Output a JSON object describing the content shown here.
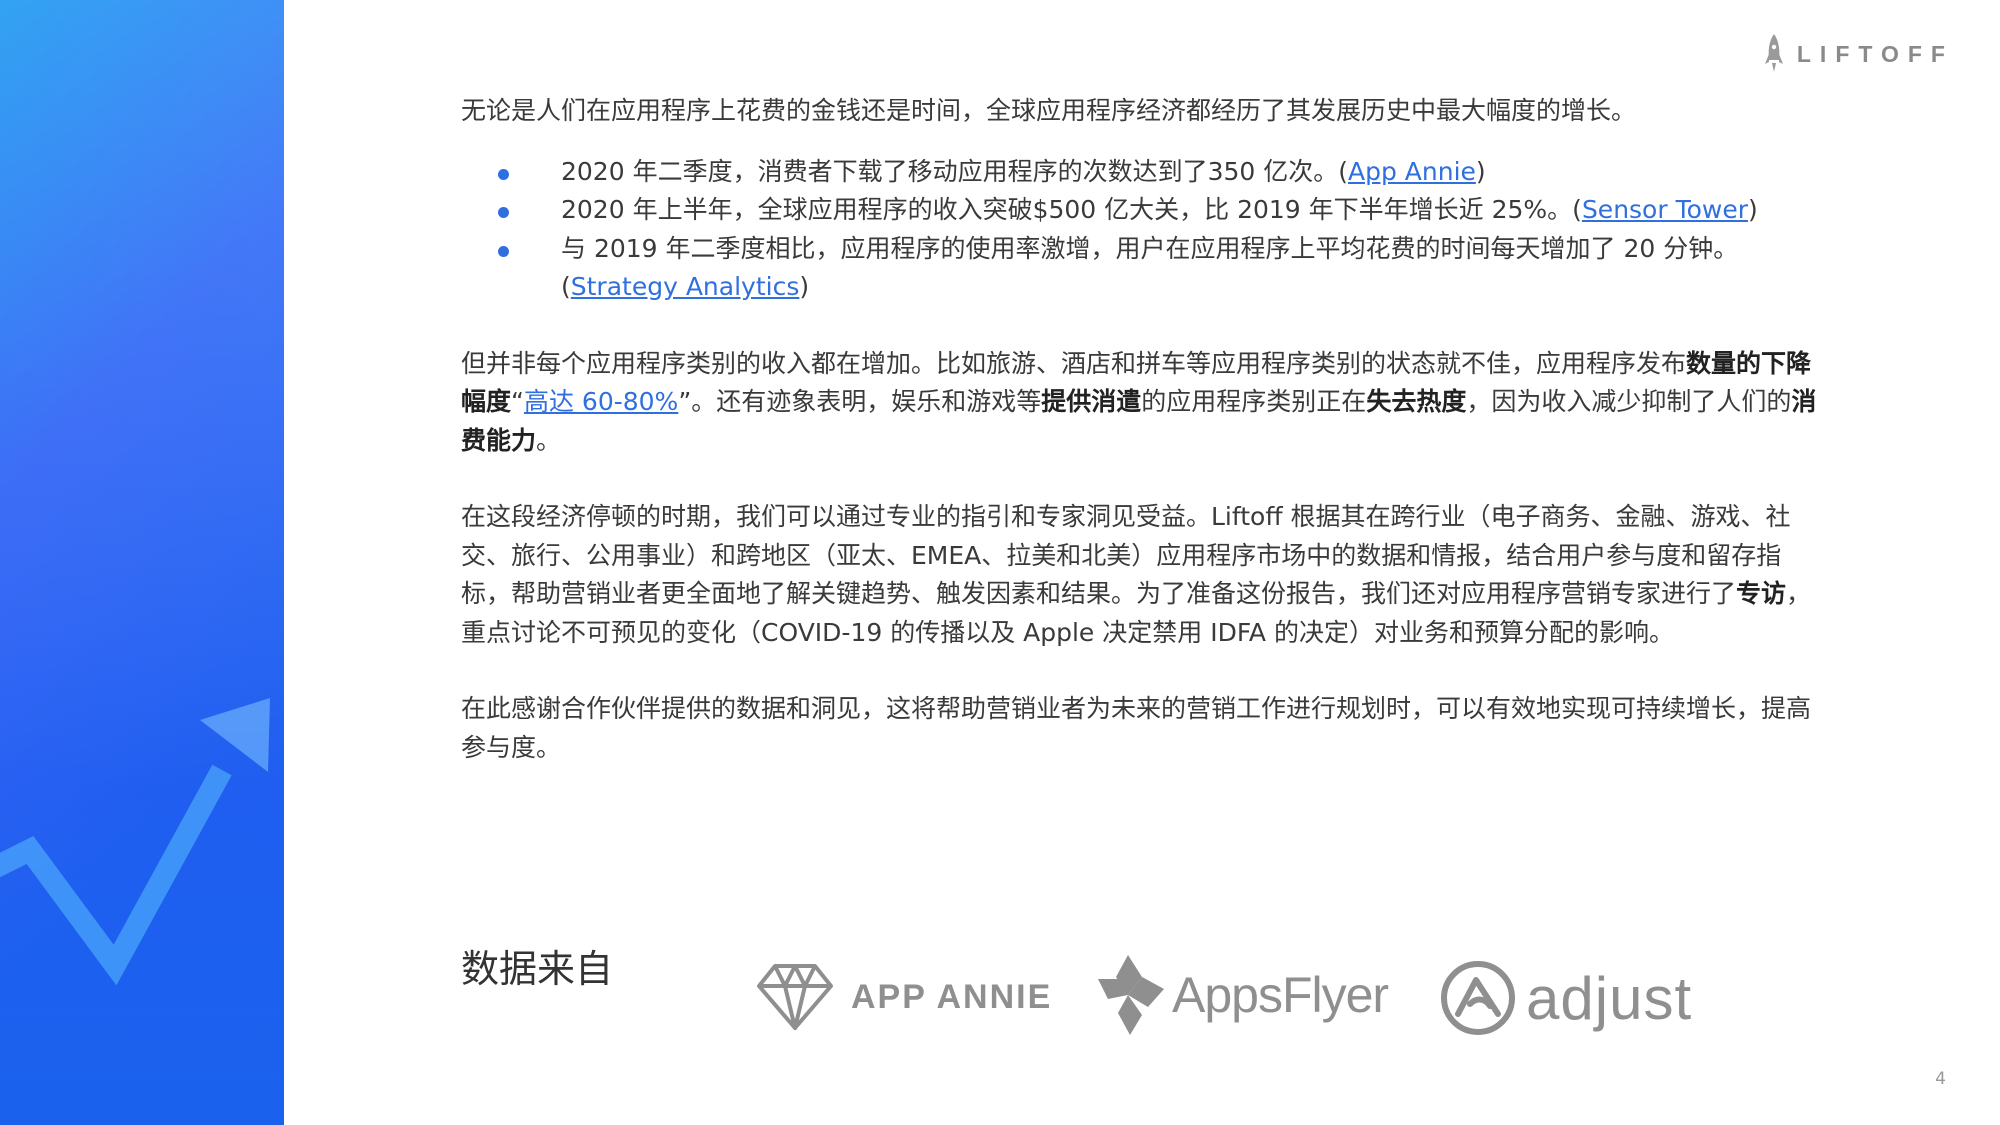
{
  "brand": {
    "logo_text": "LIFTOFF",
    "logo_icon": "rocket-icon"
  },
  "intro": "无论是人们在应用程序上花费的金钱还是时间，全球应用程序经济都经历了其发展历史中最大幅度的增长。",
  "bullets": [
    {
      "text": "2020 年二季度，消费者下载了移动应用程序的次数达到了350 亿次。(",
      "link": "App Annie",
      "close": ")"
    },
    {
      "text": "2020 年上半年，全球应用程序的收入突破$500 亿大关，比 2019 年下半年增长近 25%。(",
      "link": "Sensor Tower",
      "close": ")"
    },
    {
      "text": "与 2019 年二季度相比，应用程序的使用率激增，用户在应用程序上平均花费的时间每天增加了 20 分钟。(",
      "link": "Strategy Analytics",
      "close": ")"
    }
  ],
  "para2": {
    "t1": "但并非每个应用程序类别的收入都在增加。比如旅游、酒店和拼车等应用程序类别的状态就不佳，应用程序发布",
    "b1": "数量的下降幅度",
    "t2": "“",
    "link": "高达 60-80%",
    "t3": "”。还有迹象表明，娱乐和游戏等",
    "b2": "提供消遣",
    "t4": "的应用程序类别正在",
    "b3": "失去热度",
    "t5": "，因为收入减少抑制了人们的",
    "b4": "消费能力",
    "t6": "。"
  },
  "para3": {
    "t1": "在这段经济停顿的时期，我们可以通过专业的指引和专家洞见受益。Liftoff 根据其在跨行业（电子商务、金融、游戏、社交、旅行、公用事业）和跨地区（亚太、EMEA、拉美和北美）应用程序市场中的数据和情报，结合用户参与度和留存指标，帮助营销业者更全面地了解关键趋势、触发因素和结果。为了准备这份报告，我们还对应用程序营销专家进行了",
    "b1": "专访",
    "t2": "，重点讨论不可预见的变化（COVID-19 的传播以及 Apple 决定禁用 IDFA 的决定）对业务和预算分配的影响。"
  },
  "para4": "在此感谢合作伙伴提供的数据和洞见，这将帮助营销业者为未来的营销工作进行规划时，可以有效地实现可持续增长，提高参与度。",
  "sources": {
    "title": "数据来自",
    "partners": [
      {
        "name": "APP ANNIE",
        "icon": "diamond-icon"
      },
      {
        "name": "AppsFlyer",
        "icon": "appsflyer-icon"
      },
      {
        "name": "adjust",
        "icon": "adjust-icon"
      }
    ]
  },
  "page_number": "4",
  "colors": {
    "accent": "#2f6fdf",
    "panel_top": "#3f8ef5",
    "panel_bottom": "#1a62ee",
    "logo_gray": "#8a8a8a"
  }
}
